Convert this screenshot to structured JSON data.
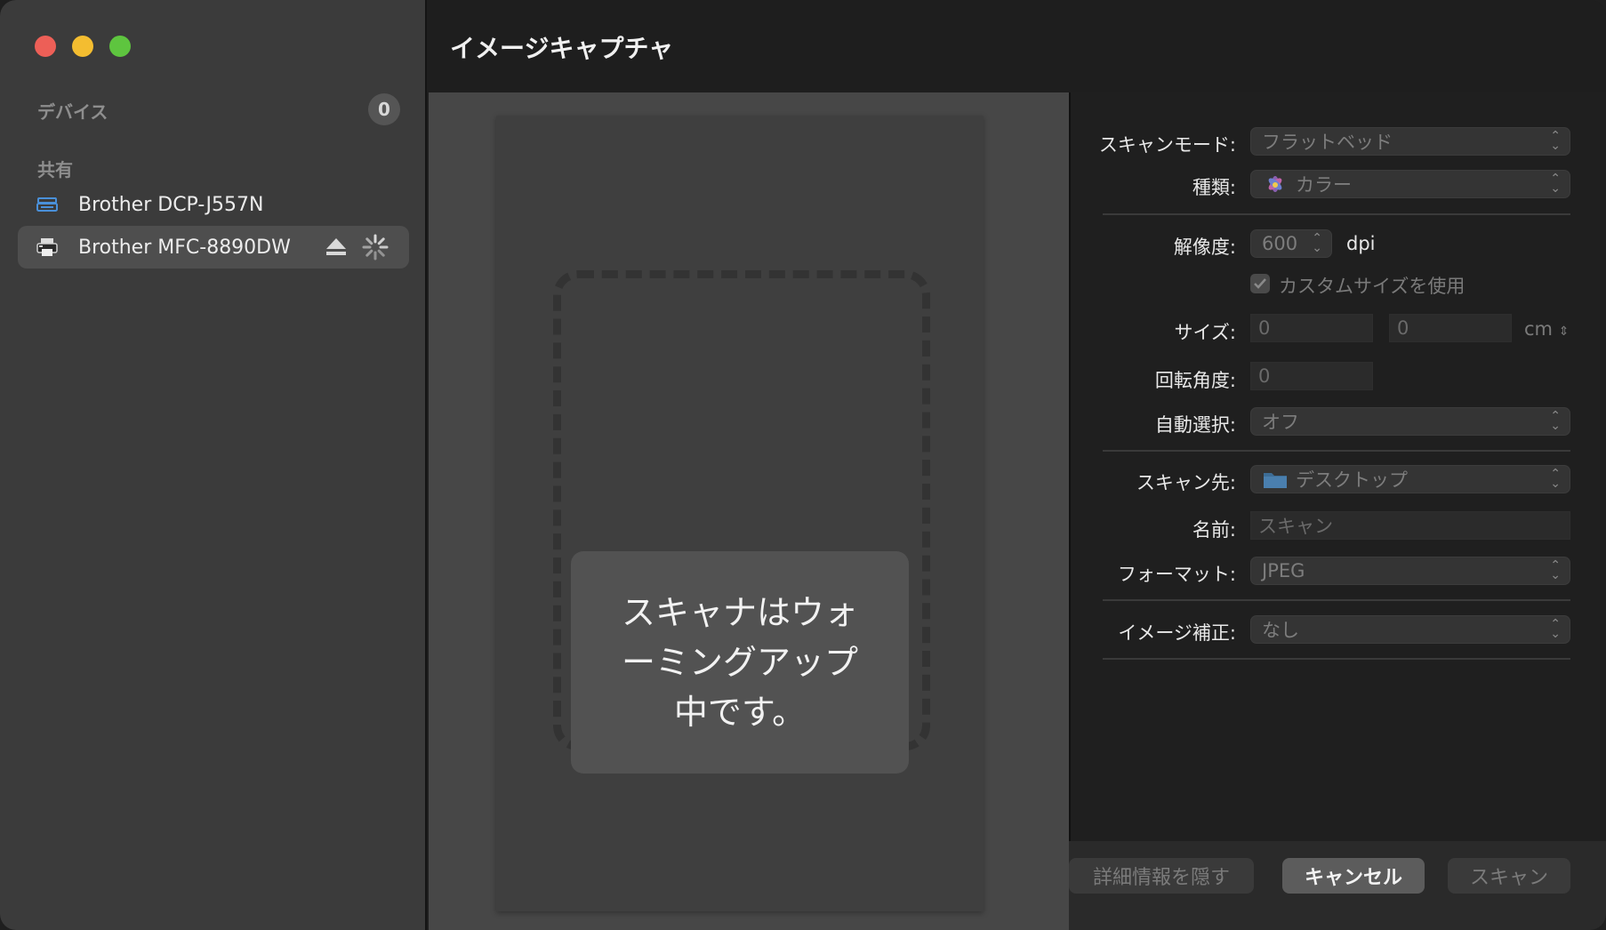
{
  "window": {
    "title": "イメージキャプチャ"
  },
  "sidebar": {
    "devices_header": "デバイス",
    "devices_count": "0",
    "shared_header": "共有",
    "items": [
      {
        "label": "Brother DCP-J557N",
        "icon": "scanner-icon",
        "selected": false
      },
      {
        "label": "Brother MFC-8890DW",
        "icon": "printer-icon",
        "selected": true
      }
    ]
  },
  "preview": {
    "message": "スキャナはウォーミングアップ中です。"
  },
  "settings": {
    "scan_mode": {
      "label": "スキャンモード:",
      "value": "フラットベッド"
    },
    "kind": {
      "label": "種類:",
      "value": "カラー",
      "icon": "color-flower-icon"
    },
    "resolution": {
      "label": "解像度:",
      "value": "600",
      "unit": "dpi"
    },
    "custom_size": {
      "label": "カスタムサイズを使用",
      "checked": true
    },
    "size": {
      "label": "サイズ:",
      "width": "0",
      "height": "0",
      "unit": "cm"
    },
    "rotation": {
      "label": "回転角度:",
      "value": "0"
    },
    "auto_select": {
      "label": "自動選択:",
      "value": "オフ"
    },
    "scan_to": {
      "label": "スキャン先:",
      "value": "デスクトップ",
      "icon": "folder-icon"
    },
    "name": {
      "label": "名前:",
      "value": "スキャン"
    },
    "format": {
      "label": "フォーマット:",
      "value": "JPEG"
    },
    "image_correction": {
      "label": "イメージ補正:",
      "value": "なし"
    }
  },
  "buttons": {
    "hide_details": "詳細情報を隠す",
    "cancel": "キャンセル",
    "scan": "スキャン"
  }
}
